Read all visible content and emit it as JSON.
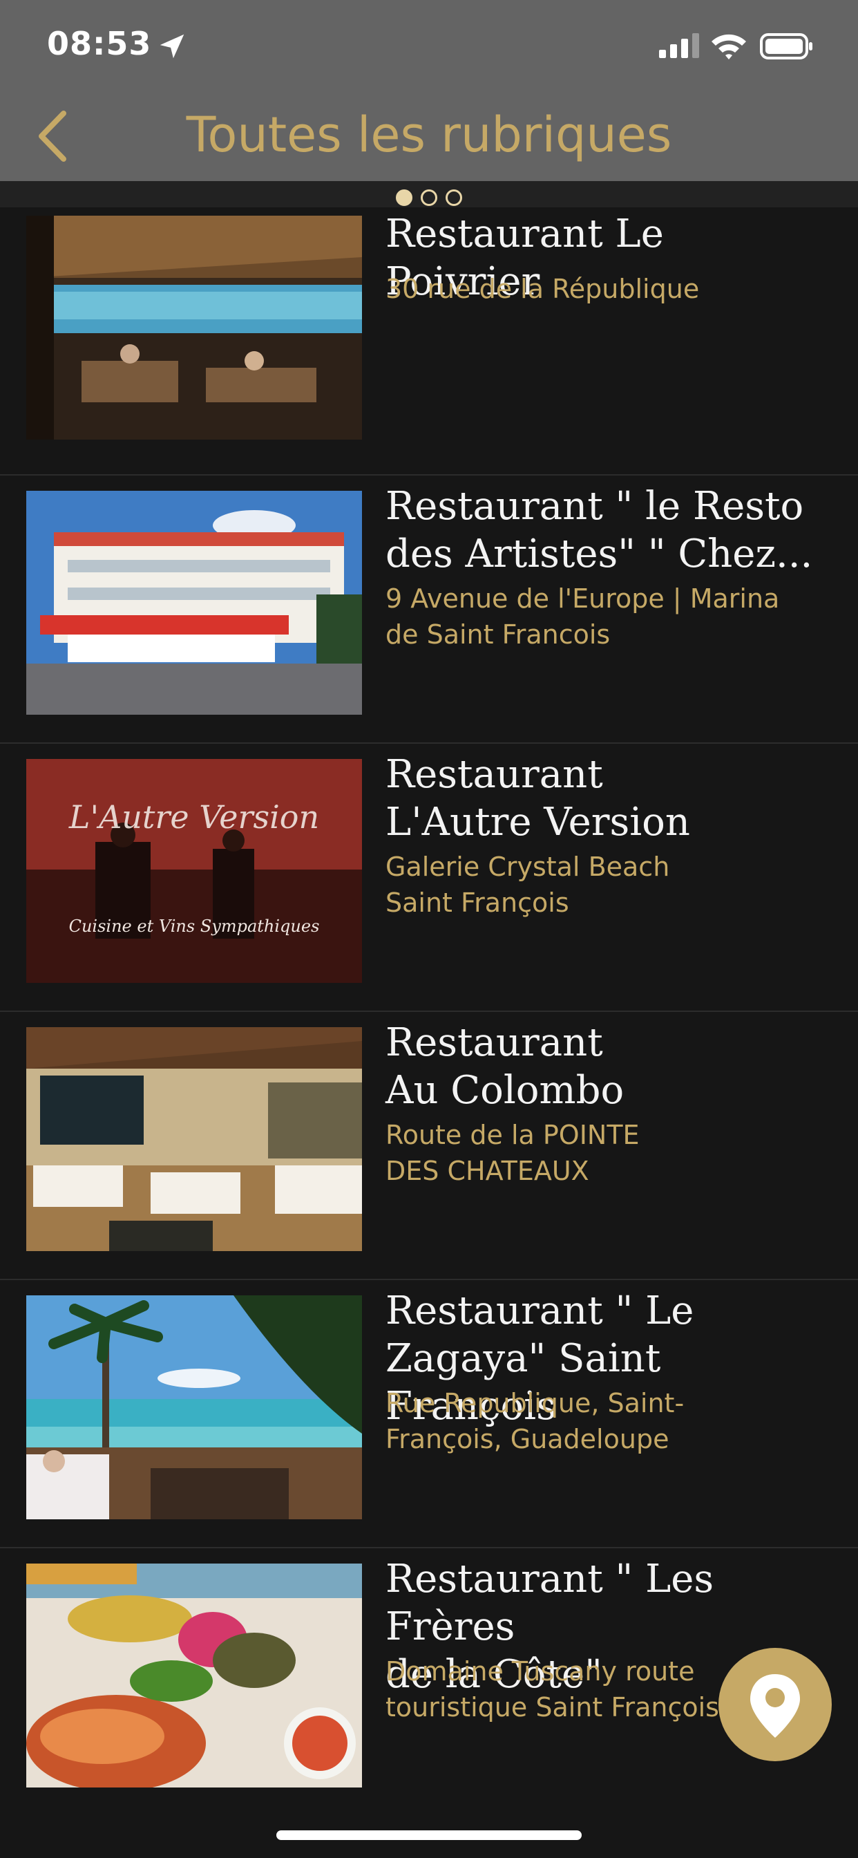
{
  "status_bar": {
    "time": "08:53"
  },
  "nav": {
    "title": "Toutes les rubriques"
  },
  "pager": {
    "pages": 3,
    "current": 1
  },
  "items": [
    {
      "title": "Restaurant Le Poivrier",
      "address": "30 rue de la République"
    },
    {
      "title": "Restaurant \" le Resto\ndes Artistes\"  \" Chez...",
      "address": "9 Avenue de l'Europe | Marina\nde Saint Francois"
    },
    {
      "title": "Restaurant\nL'Autre Version",
      "address": "Galerie Crystal Beach\nSaint François",
      "image_text": [
        "L'Autre Version",
        "Cuisine et Vins Sympathiques"
      ]
    },
    {
      "title": "Restaurant\nAu Colombo",
      "address": "Route de la POINTE\nDES CHATEAUX"
    },
    {
      "title": "Restaurant \" Le\nZagaya\" Saint François",
      "address": "Rue Republique, Saint-\nFrançois, Guadeloupe"
    },
    {
      "title": "Restaurant \" Les Frères\nde la Côte\"",
      "address": "Domaine Tuscany route\ntouristique Saint François"
    }
  ],
  "colors": {
    "accent": "#c6a966",
    "header_bg": "#646464",
    "list_bg": "#161616",
    "title_text": "#f3f3f3"
  }
}
